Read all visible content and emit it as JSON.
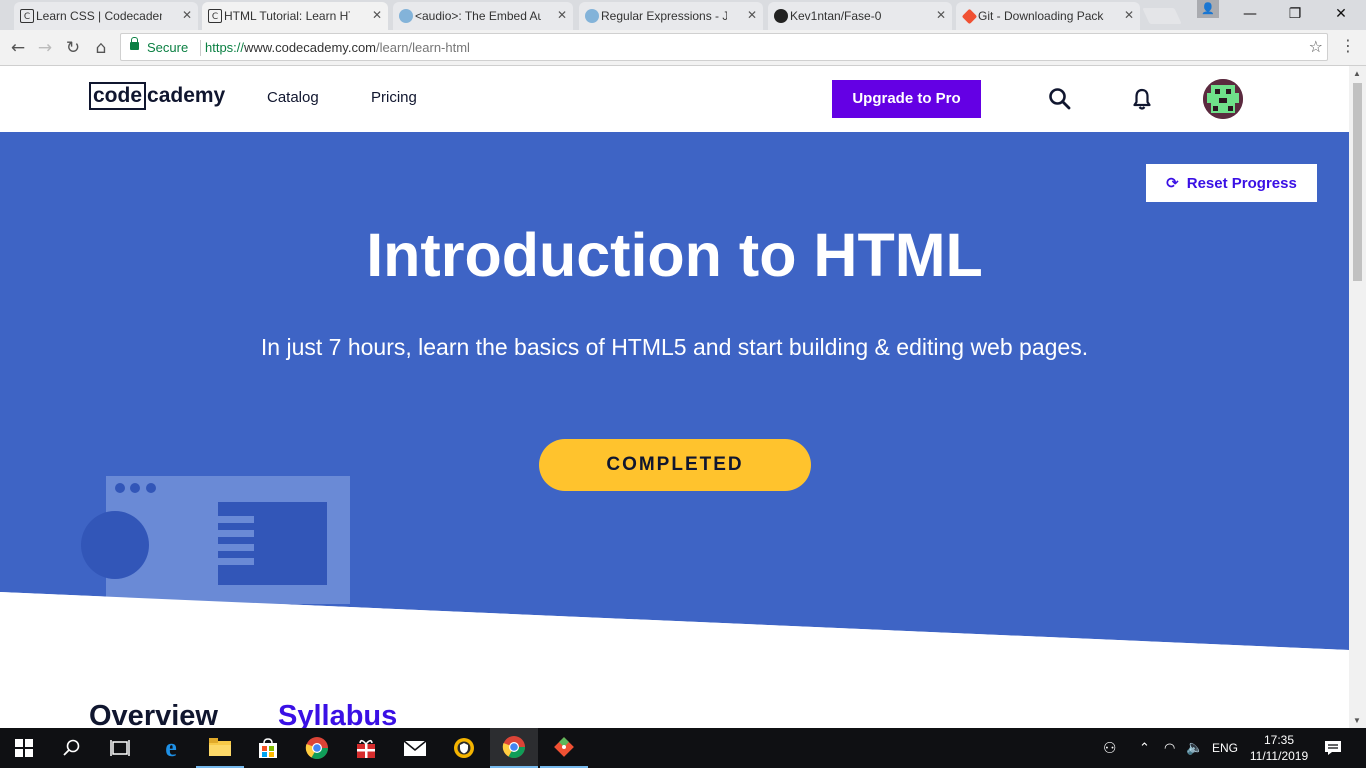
{
  "browser": {
    "tabs": [
      {
        "title": "Learn CSS | Codecademy",
        "favicon": "codecademy-icon",
        "active": false
      },
      {
        "title": "HTML Tutorial: Learn HTML",
        "favicon": "codecademy-icon",
        "active": true
      },
      {
        "title": "<audio>: The Embed Audio",
        "favicon": "mdn-icon",
        "active": false
      },
      {
        "title": "Regular Expressions - JavaScript",
        "favicon": "mdn-icon",
        "active": false
      },
      {
        "title": "Kev1ntan/Fase-0",
        "favicon": "github-icon",
        "active": false
      },
      {
        "title": "Git - Downloading Package",
        "favicon": "git-icon",
        "active": false
      }
    ],
    "secure_label": "Secure",
    "url_scheme": "https://",
    "url_host": "www.codecademy.com",
    "url_path": "/learn/learn-html"
  },
  "site": {
    "logo_box": "code",
    "logo_rest": "cademy",
    "nav": {
      "catalog": "Catalog",
      "pricing": "Pricing"
    },
    "upgrade_label": "Upgrade to Pro"
  },
  "hero": {
    "reset_label": "Reset Progress",
    "title": "Introduction to HTML",
    "subtitle": "In just 7 hours, learn the basics of HTML5 and start building & editing web pages.",
    "cta_label": "COMPLETED",
    "bg_color": "#3e64c5",
    "cta_color": "#ffc32d"
  },
  "section_tabs": {
    "overview": "Overview",
    "syllabus": "Syllabus"
  },
  "taskbar": {
    "language": "ENG",
    "time": "17:35",
    "date": "11/11/2019"
  }
}
